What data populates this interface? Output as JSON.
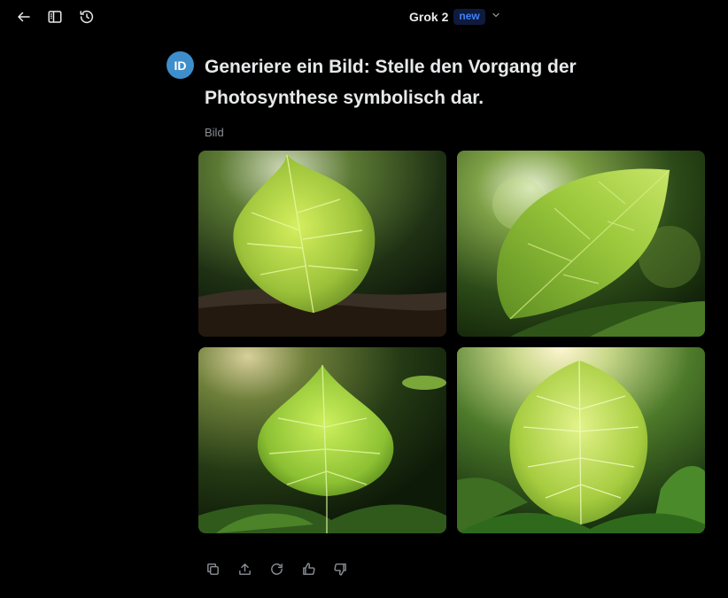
{
  "header": {
    "model_name": "Grok 2",
    "model_badge": "new",
    "icons": [
      "back-arrow-icon",
      "sidebar-toggle-icon",
      "history-icon",
      "chevron-down-icon"
    ]
  },
  "message": {
    "avatar_initials": "ID",
    "prompt_text": "Generiere ein Bild: Stelle den Vorgang der Photosynthese symbolisch dar.",
    "result_label": "Bild"
  },
  "images": [
    {
      "description": "heart-shaped leaf on soil"
    },
    {
      "description": "leaf in sunlit forest"
    },
    {
      "description": "leaf among foliage"
    },
    {
      "description": "backlit leaf in sunlight"
    }
  ],
  "actions": [
    "copy-icon",
    "share-icon",
    "regenerate-icon",
    "thumbs-up-icon",
    "thumbs-down-icon"
  ],
  "colors": {
    "background": "#000000",
    "badge_text": "#3b82f6",
    "avatar": "#3e8ecb",
    "muted": "#8b8f94"
  }
}
